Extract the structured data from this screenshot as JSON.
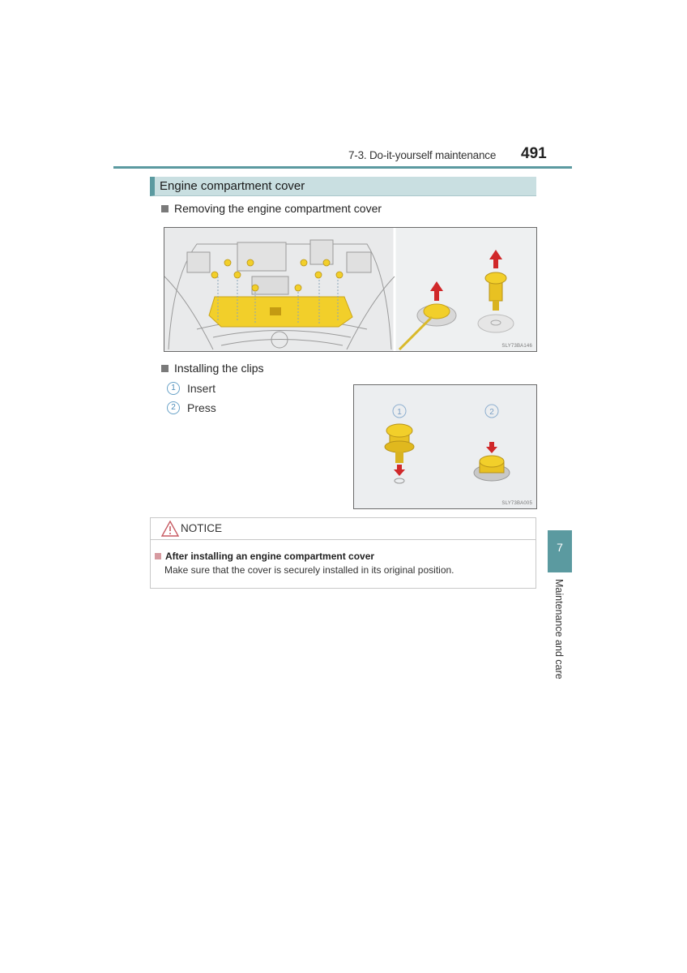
{
  "header": {
    "section": "7-3. Do-it-yourself maintenance",
    "page_number": "491"
  },
  "section_title": "Engine compartment cover",
  "removing": {
    "heading": "Removing the engine compartment cover",
    "figure_code": "SLY73BA146"
  },
  "installing": {
    "heading": "Installing the clips",
    "steps": [
      {
        "number": "1",
        "label": "Insert"
      },
      {
        "number": "2",
        "label": "Press"
      }
    ],
    "figure_code": "SLY73BA005"
  },
  "notice": {
    "label": "NOTICE",
    "subheading": "After installing an engine compartment cover",
    "body": "Make sure that the cover is securely installed in its original position."
  },
  "side_tab": {
    "chapter": "7",
    "label": "Maintenance and care"
  },
  "colors": {
    "accent": "#5b9aa0",
    "title_bg": "#c9dfe1",
    "clip_yellow": "#f2cf2a",
    "arrow_red": "#d0282a",
    "notice_pink": "#d79aa0"
  }
}
